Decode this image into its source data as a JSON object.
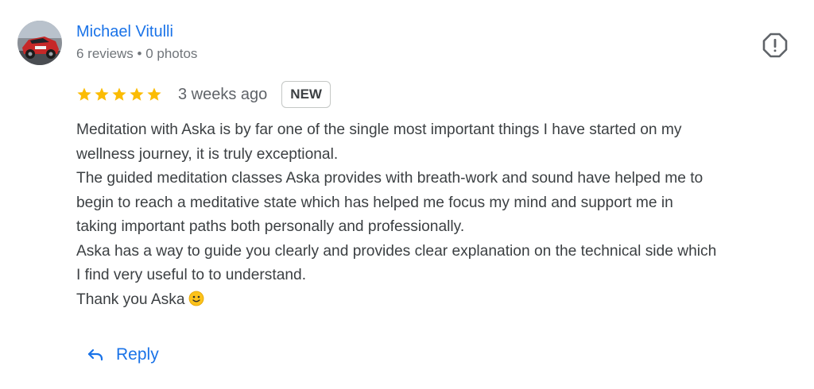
{
  "reviewer": {
    "name": "Michael Vitulli",
    "meta": "6 reviews • 0 photos",
    "avatar_icon": "car-photo-avatar"
  },
  "review": {
    "rating": 5,
    "rating_max": 5,
    "date": "3 weeks ago",
    "badge": "NEW",
    "lines": [
      "Meditation with Aska is by far one of the single most important things I have started on my",
      "wellness journey, it is truly exceptional.",
      "The guided meditation classes Aska provides with breath-work and sound have helped me to",
      "begin to reach a meditative state which has helped me focus my mind and support me in",
      "taking important paths both personally and professionally.",
      "Aska has a way to guide you clearly and provides clear explanation on the technical side which",
      "I find very useful to to understand.",
      "Thank you Aska"
    ],
    "closing_emoji": "slightly-smiling-face-emoji"
  },
  "actions": {
    "report_icon": "report-icon",
    "reply_label": "Reply",
    "reply_icon": "reply-arrow-icon"
  },
  "colors": {
    "link_blue": "#1a73e8",
    "star_gold": "#fbbc04",
    "text": "#3c4043",
    "meta_gray": "#70757a"
  }
}
